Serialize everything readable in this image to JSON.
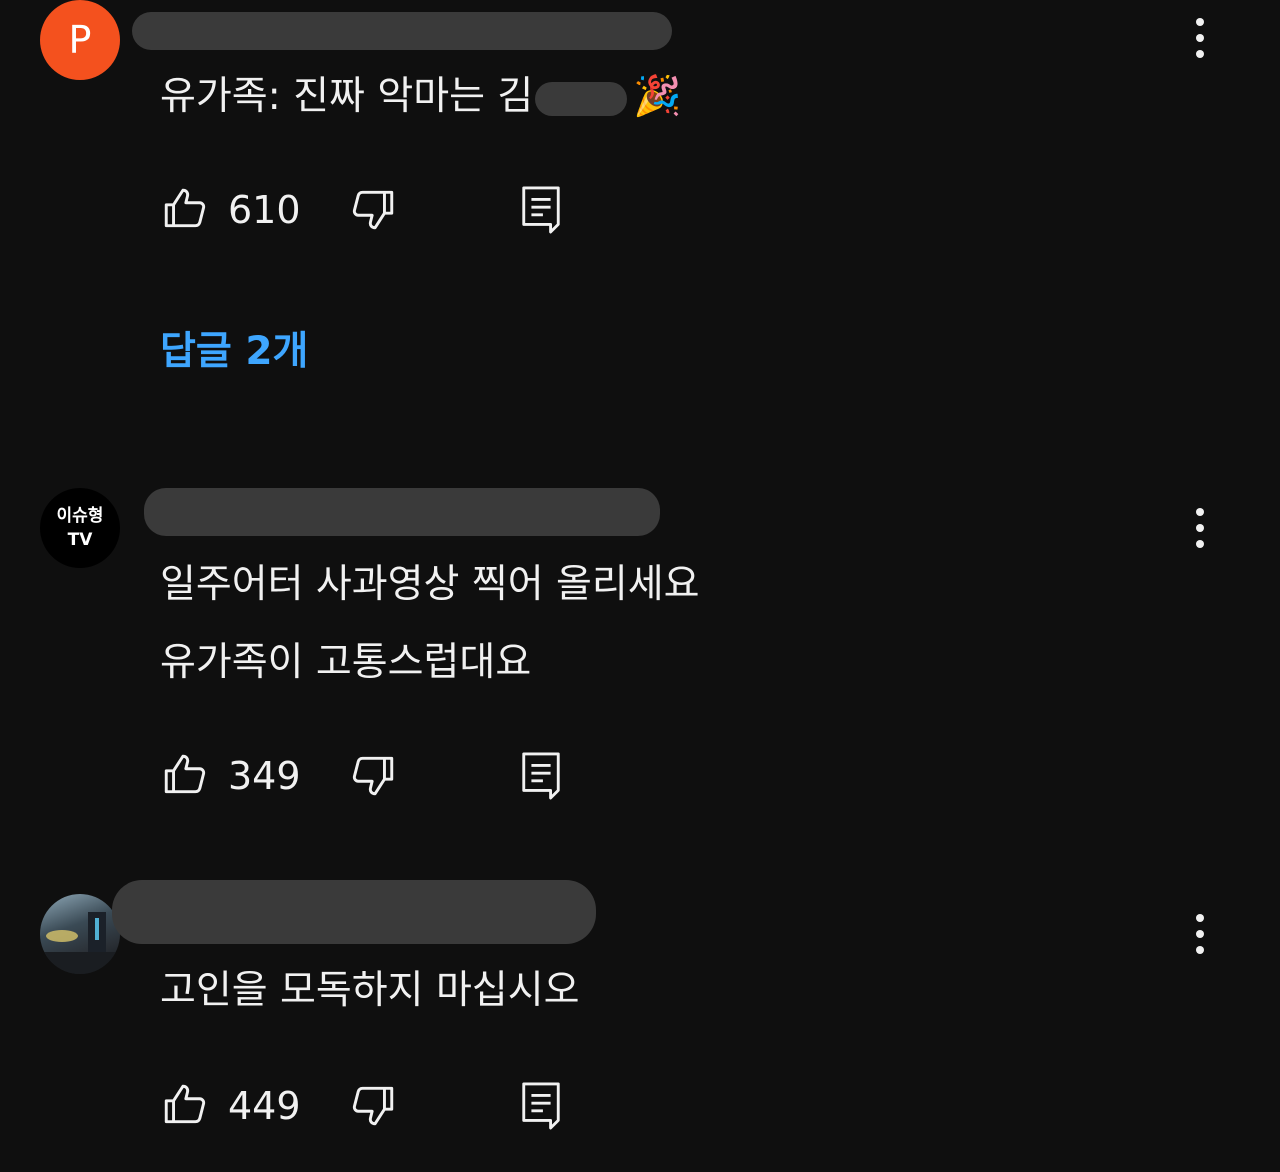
{
  "comments": [
    {
      "avatar_letter": "P",
      "avatar_color": "#f4511e",
      "text_lines": [
        "유가족: 진짜 악마는 김",
        "🎉"
      ],
      "likes": "610",
      "replies_label": "답글 2개"
    },
    {
      "avatar_lines": [
        "이슈형",
        "TV"
      ],
      "text_lines": [
        "일주어터 사과영상 찍어 올리세요",
        "유가족이 고통스럽대요"
      ],
      "likes": "349"
    },
    {
      "avatar_icon": "photo-avatar",
      "text_lines": [
        "고인을 모독하지 마십시오"
      ],
      "likes": "449"
    }
  ],
  "icons": {
    "like": "thumbs-up-icon",
    "dislike": "thumbs-down-icon",
    "reply": "reply-icon",
    "more": "more-vertical-icon"
  },
  "colors": {
    "background": "#0f0f0f",
    "link": "#3ea6ff",
    "text": "#f1f1f1"
  }
}
